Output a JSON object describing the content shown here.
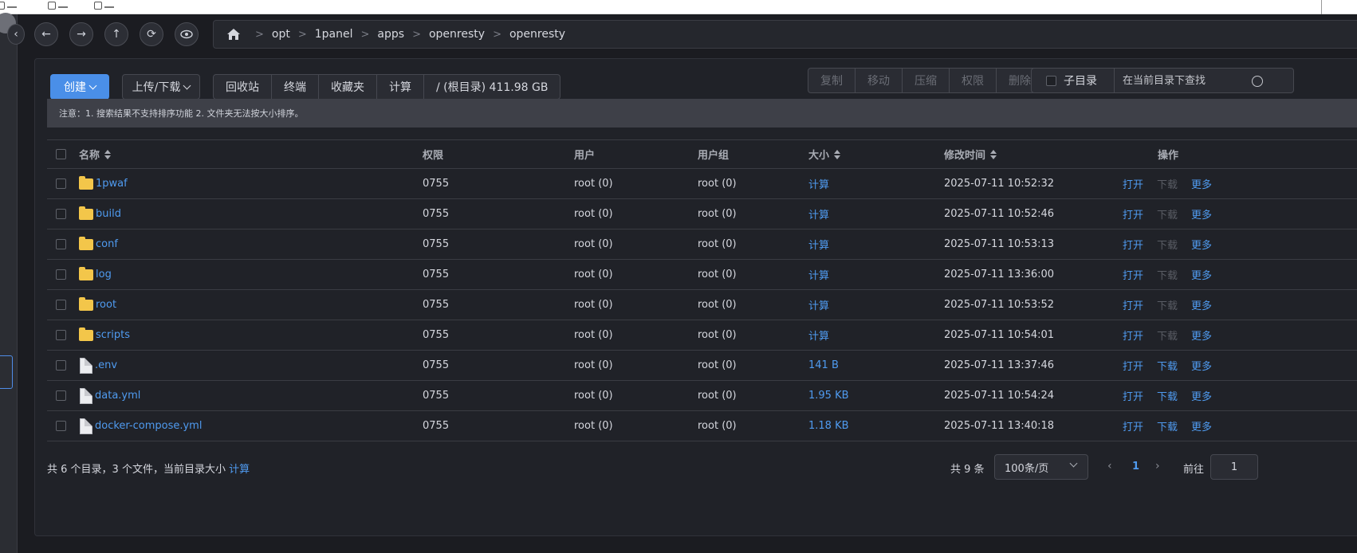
{
  "nav": {
    "breadcrumb": [
      "opt",
      "1panel",
      "apps",
      "openresty",
      "openresty"
    ],
    "separator": ">"
  },
  "toolbar": {
    "create_label": "创建",
    "upload_label": "上传/下载",
    "group": [
      "回收站",
      "终端",
      "收藏夹",
      "计算",
      "/ (根目录) 411.98 GB"
    ],
    "actions": [
      "复制",
      "移动",
      "压缩",
      "权限",
      "删除"
    ],
    "subdir_label": "子目录",
    "search_placeholder": "在当前目录下查找"
  },
  "notice": "注意：1. 搜索结果不支持排序功能 2. 文件夹无法按大小排序。",
  "table": {
    "headers": {
      "name": "名称",
      "perm": "权限",
      "user": "用户",
      "group": "用户组",
      "size": "大小",
      "time": "修改时间",
      "ops": "操作"
    },
    "op_labels": {
      "open": "打开",
      "download": "下载",
      "more": "更多"
    },
    "rows": [
      {
        "name": "1pwaf",
        "type": "folder",
        "perm": "0755",
        "user": "root (0)",
        "group": "root (0)",
        "size": "计算",
        "time": "2025-07-11 10:52:32"
      },
      {
        "name": "build",
        "type": "folder",
        "perm": "0755",
        "user": "root (0)",
        "group": "root (0)",
        "size": "计算",
        "time": "2025-07-11 10:52:46"
      },
      {
        "name": "conf",
        "type": "folder",
        "perm": "0755",
        "user": "root (0)",
        "group": "root (0)",
        "size": "计算",
        "time": "2025-07-11 10:53:13"
      },
      {
        "name": "log",
        "type": "folder",
        "perm": "0755",
        "user": "root (0)",
        "group": "root (0)",
        "size": "计算",
        "time": "2025-07-11 13:36:00"
      },
      {
        "name": "root",
        "type": "folder",
        "perm": "0755",
        "user": "root (0)",
        "group": "root (0)",
        "size": "计算",
        "time": "2025-07-11 10:53:52"
      },
      {
        "name": "scripts",
        "type": "folder",
        "perm": "0755",
        "user": "root (0)",
        "group": "root (0)",
        "size": "计算",
        "time": "2025-07-11 10:54:01"
      },
      {
        "name": ".env",
        "type": "file",
        "perm": "0755",
        "user": "root (0)",
        "group": "root (0)",
        "size": "141 B",
        "time": "2025-07-11 13:37:46"
      },
      {
        "name": "data.yml",
        "type": "file",
        "perm": "0755",
        "user": "root (0)",
        "group": "root (0)",
        "size": "1.95 KB",
        "time": "2025-07-11 10:54:24"
      },
      {
        "name": "docker-compose.yml",
        "type": "file",
        "perm": "0755",
        "user": "root (0)",
        "group": "root (0)",
        "size": "1.18 KB",
        "time": "2025-07-11 13:40:18"
      }
    ]
  },
  "footer": {
    "summary_prefix": "共 6 个目录，3 个文件，当前目录大小",
    "summary_link": "计算",
    "total": "共 9 条",
    "page_size": "100条/页",
    "current_page": "1",
    "goto_label": "前往",
    "goto_value": "1"
  }
}
